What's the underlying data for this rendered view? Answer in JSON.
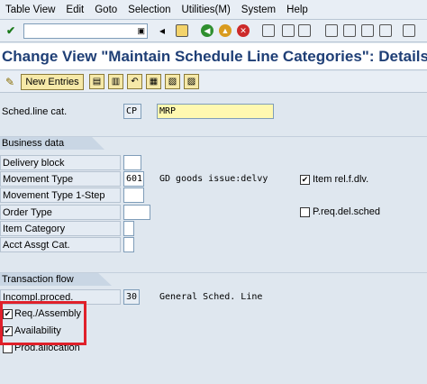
{
  "menu": [
    "Table View",
    "Edit",
    "Goto",
    "Selection",
    "Utilities(M)",
    "System",
    "Help"
  ],
  "title": "Change View \"Maintain Schedule Line Categories\": Details",
  "toolbar": {
    "new_entries": "New Entries"
  },
  "header": {
    "sched_label": "Sched.line cat.",
    "sched_code": "CP",
    "sched_desc": "MRP"
  },
  "business_data": {
    "title": "Business data",
    "delivery_block": "Delivery block",
    "movement_type": "Movement Type",
    "movement_type_value": "601",
    "movement_type_desc": "GD goods issue:delvy",
    "movement_type_1step": "Movement Type 1-Step",
    "order_type": "Order Type",
    "item_category": "Item Category",
    "acct_assgt_cat": "Acct Assgt Cat.",
    "item_rel_fdlv": "Item rel.f.dlv.",
    "item_rel_fdlv_checked": true,
    "preq_del_sched": "P.req.del.sched",
    "preq_del_sched_checked": false
  },
  "transaction_flow": {
    "title": "Transaction flow",
    "incompl_proced": "Incompl.proced.",
    "incompl_value": "30",
    "incompl_desc": "General Sched. Line",
    "req_assembly": "Req./Assembly",
    "req_assembly_checked": true,
    "availability": "Availability",
    "availability_checked": true,
    "prod_allocation": "Prod.allocation",
    "prod_allocation_checked": false
  },
  "colors": {
    "title": "#1f3f76",
    "highlight": "#e0202a",
    "button": "#f6e9a8",
    "required": "#fff8b0"
  }
}
